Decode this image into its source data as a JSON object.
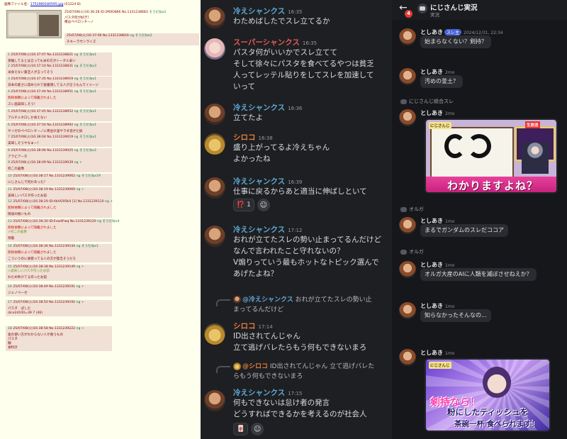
{
  "board": {
    "op": {
      "file_label": "画像ファイル名：",
      "file_link": "1751960180595.jpg",
      "file_size": "-(51224 B)",
      "meta": "25/07/08(火)16:36:28 ID:2MXO866 No.1331238683",
      "sodane": "そうだねx2",
      "text1": "パスタ何が好き？",
      "text2": "俺はペペロンチーノ",
      "reply_meta": "25/07/08(火)16:37:06 No.1331238816",
      "reply_ng": "ng",
      "reply_sodane": "そうだねx2",
      "reply_text": "チキーラサンライズ"
    },
    "replies": [
      {
        "n": "1",
        "meta": "25/07/08(火)16:37:07 No.1331238821",
        "ng": "ng",
        "sodane": "そうだねx1",
        "text": "蒸麺してるとは言っても米の方がトータル安い"
      },
      {
        "n": "2",
        "meta": "25/07/08(火)16:37:10 No.1331238831",
        "ng": "ng",
        "sodane": "そうだねx3",
        "text": "米食えない貧乏人が言ってそう"
      },
      {
        "n": "3",
        "meta": "25/07/08(火)16:37:35 No.1331238919",
        "ng": "ng",
        "sodane": "そうだねx1",
        "text": "日本の麦さに認められて粘着親してる人が言うもんでイメージ"
      },
      {
        "n": "4",
        "meta": "25/07/08(火)16:37:44 No.1331238951",
        "ng": "ng",
        "sodane": "そうだねx1",
        "del": "削除依頼によって隔離されました",
        "text": "スレ画美味しそう！"
      },
      {
        "n": "5",
        "meta": "25/07/08(火)16:37:45 No.1331238952",
        "ng": "ng",
        "sodane": "そうだねx1",
        "text": "アルチェネロしか食えない"
      },
      {
        "n": "6",
        "meta": "25/07/08(火)16:37:54 No.1331238992",
        "ng": "ng",
        "sodane": "そうだねx1",
        "text": "サイゼのペペロンチーノに青豆の温サラダ混ぜた奴"
      },
      {
        "n": "7",
        "meta": "25/07/08(火)16:38:04 No.1331239019",
        "ng": "ng",
        "sodane": "そうだねx1",
        "text": "美味しそうやなぁー！"
      },
      {
        "n": "8",
        "meta": "25/07/08(火)16:38:06 No.1331239025",
        "ng": "ng",
        "sodane": "そうだねx2",
        "text": "アラビアータ"
      },
      {
        "n": "9",
        "meta": "25/07/08(火)16:38:09 No.1331239039",
        "ng": "ng",
        "sodane": "+",
        "text": "何この画像"
      },
      {
        "n": "10",
        "meta": "25/07/08(火)16:38:17 No.1331239062",
        "ng": "ng",
        "sodane": "そうだねx19",
        "text": "にじさんじで何かあった？"
      },
      {
        "n": "11",
        "meta": "25/07/08(火)16:38:19 No.1331239069",
        "ng": "ng",
        "sodane": "+",
        "text": "美味しいパスタ作ったお前"
      },
      {
        "n": "12",
        "meta": "25/07/08(火)16:38:29 ID:AbVG95K4 [1] No.1331239110",
        "ng": "ng",
        "sodane": "+",
        "del": "削除依頼によって隔離されました",
        "text": "情弱の極いもの"
      },
      {
        "n": "13",
        "meta": "25/07/08(火)16:38:30 ID:Evw4Fwq No.1331239120",
        "ng": "ng",
        "sodane": "そうだねx4",
        "del": "削除依頼によって隔離されました",
        "quote": ">何この画像",
        "text": "残骸"
      },
      {
        "n": "14",
        "meta": "25/07/08(火)16:38:36 No.1331239144",
        "ng": "ng",
        "sodane": "そうだねx1",
        "del": "削除依頼によって隔離されました",
        "text": "こういうのに姿使ってる人の方が貧乏そうだろ"
      },
      {
        "n": "15",
        "meta": "25/07/08(火)16:38:38 No.1331239149",
        "ng": "ng",
        "sodane": "+",
        "quote": ">美味しいパスタ作ったお前",
        "text": "わため吹けてる作ったお前"
      },
      {
        "n": "16",
        "meta": "25/07/08(火)16:38:49 No.1331239191",
        "ng": "ng",
        "sodane": "+",
        "text": "ジェノベーゼ"
      },
      {
        "n": "17",
        "meta": "25/07/08(火)16:38:50 No.1331239192",
        "ng": "ng",
        "sodane": "+",
        "text": "パスタ　ぱした",
        "text2": "dice2d100=39 7 (46)"
      },
      {
        "n": "18",
        "meta": "25/07/08(火)16:38:58 No.1331239222",
        "ng": "ng",
        "sodane": "+",
        "text": "金の使い方がわからない人が買うもの",
        "text2": "パスタ",
        "text3": "麺",
        "text4": "食料計"
      }
    ]
  },
  "discord": {
    "colors": {
      "blue": "#5fa8d6",
      "red": "#e25a5a",
      "orange": "#e67e3b"
    },
    "messages": [
      {
        "author": "冷えシャンクス",
        "time": "16:35",
        "lines": [
          "わためばしたでスレ立てるか"
        ]
      },
      {
        "author": "スーパーシャンクス",
        "time": "16:35",
        "lines": [
          "パスタ何がいいかでスレ立てて",
          "そして徐々にパスタを食べてるやつは貧乏",
          "人ってレッテル貼りをしてスレを加速して",
          "いって"
        ]
      },
      {
        "author": "冷えシャンクス",
        "time": "16:36",
        "lines": [
          "立てたよ"
        ]
      },
      {
        "author": "シロコ",
        "time": "16:38",
        "lines": [
          "盛り上がってるよ冷えちゃん",
          "よかったね"
        ]
      },
      {
        "author": "冷えシャンクス",
        "time": "16:39",
        "lines": [
          "仕事に戻るからあと適当に伸ばしといて"
        ],
        "reaction_emoji": "⁉️",
        "reaction_count": "1"
      },
      {
        "author": "冷えシャンクス",
        "time": "17:12",
        "lines": [
          "おれが立てたスレの勢い止まってるんだけど",
          "なんで言われたこと守れないの？",
          "V煽りっていう最もホットなトピック選んで",
          "あげたよね？"
        ]
      },
      {
        "author": "シロコ",
        "time": "17:14",
        "reply_to_name": "@冷えシャンクス",
        "reply_to_text": "おれが立てたスレの勢い止",
        "reply_to_text2": "まってるんだけど",
        "lines": [
          "ID出されてんじゃん",
          "立て逃げバレたらもう何もできないまろ"
        ]
      },
      {
        "author": "冷えシャンクス",
        "time": "17:15",
        "reply_to_name": "@シロコ",
        "reply_to_text": "ID出されてんじゃん 立て逃げバレた",
        "reply_to_text2": "らもう何もできないまろ",
        "lines": [
          "何もできないは怠け者の発言",
          "どうすればできるかを考えるのが社会人"
        ],
        "reaction_emoji": "🀄"
      }
    ]
  },
  "chat": {
    "back_icon": "back-arrow-icon",
    "badge": "4",
    "title": "にじさんじ実況",
    "subtitle": "実況",
    "messages": [
      {
        "name": "としあき",
        "tag": "スレ主",
        "time": "2024/12/31, 22:34",
        "text": "始まらなくない？剣持？"
      },
      {
        "name": "としあき",
        "time": "2mo",
        "text": "汚めの釜土？"
      },
      {
        "section": "にじさんじ総合スレ"
      },
      {
        "name": "としあき",
        "time": "2mo",
        "image_caption": "わかりますよね？",
        "image_logo": "にじさんじ",
        "image_live": "生放送"
      },
      {
        "section": "オルガ"
      },
      {
        "name": "としあき",
        "time": "1mo",
        "text": "まるでガンダムのスレだココア"
      },
      {
        "section": "オルガ"
      },
      {
        "name": "としあき",
        "time": "1mo",
        "text": "オルガ大産のAIに人類を滅ぼさせねえか？"
      },
      {
        "name": "としあき",
        "time": "1mo",
        "text": "知らなかったそんなの..."
      },
      {
        "name": "としあき",
        "time": "1mo",
        "image_caption1": "剣持なら！",
        "image_caption2": "粉にしたティッシュを",
        "image_caption3": "茶碗一杯 食べられます！",
        "image_logo": "にじさんじ"
      }
    ]
  }
}
